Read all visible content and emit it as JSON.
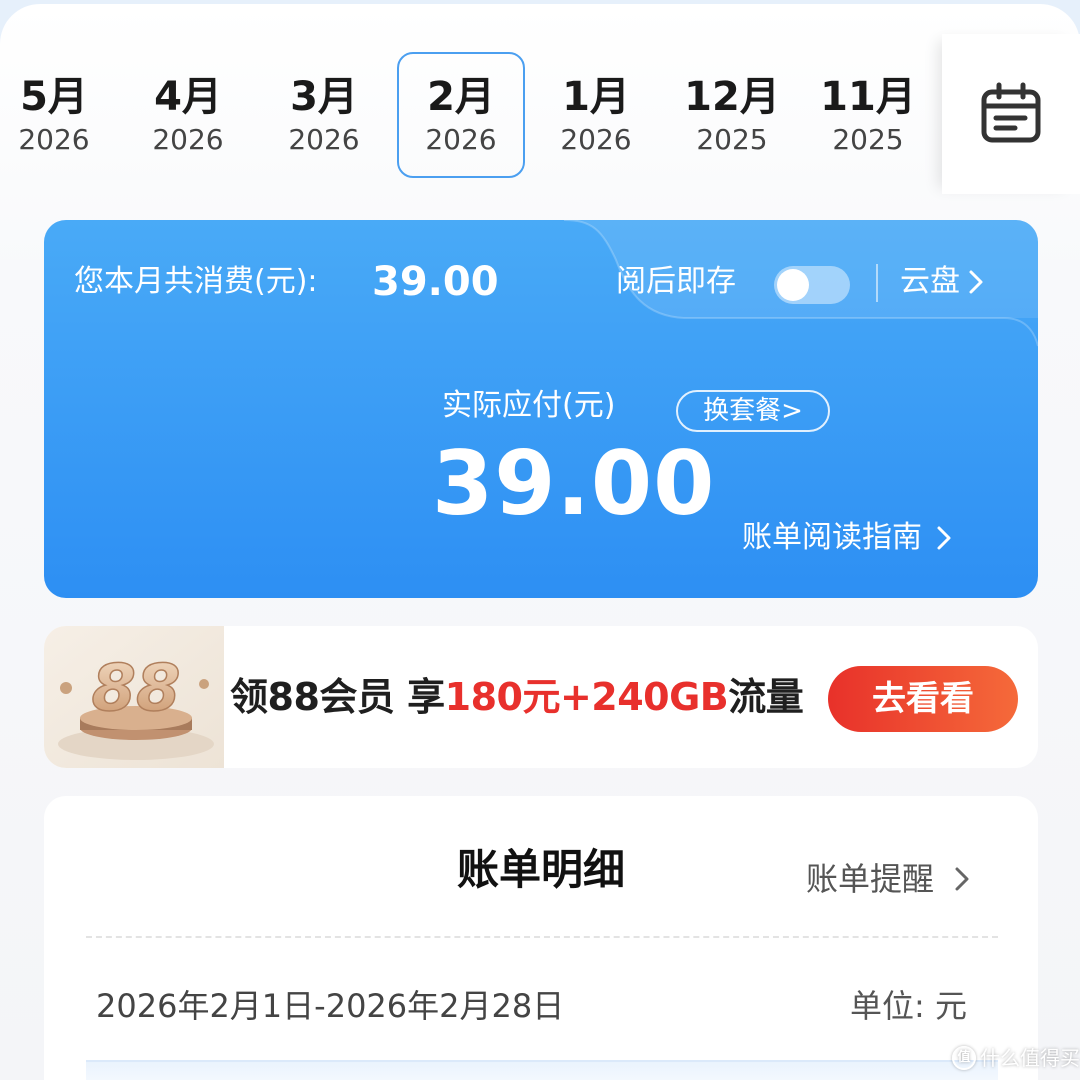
{
  "months": [
    {
      "month": "5月",
      "year": "2026"
    },
    {
      "month": "4月",
      "year": "2026"
    },
    {
      "month": "3月",
      "year": "2026"
    },
    {
      "month": "2月",
      "year": "2026"
    },
    {
      "month": "1月",
      "year": "2026"
    },
    {
      "month": "12月",
      "year": "2025"
    },
    {
      "month": "11月",
      "year": "2025"
    }
  ],
  "selected_month": "2月 2026",
  "calendar_icon": "calendar-icon",
  "summary": {
    "total_label": "您本月共消费(元):",
    "total_value": "39.00",
    "save_after_read_label": "阅后即存",
    "save_after_read_on": false,
    "cloud_label": "云盘",
    "actual_label": "实际应付(元)",
    "actual_value": "39.00",
    "change_plan_label": "换套餐>",
    "guide_label": "账单阅读指南"
  },
  "promo": {
    "badge": "88",
    "text_prefix": "领88会员 享",
    "text_highlight": "180元+240GB",
    "text_suffix": "流量",
    "button_label": "去看看"
  },
  "detail": {
    "title": "账单明细",
    "remind_label": "账单提醒",
    "period": "2026年2月1日-2026年2月28日",
    "unit": "单位: 元"
  },
  "watermark": {
    "mark": "值",
    "text": "什么值得买"
  },
  "colors": {
    "accent_blue": "#2d8ff3",
    "selected_border": "#4b9ff0",
    "promo_red": "#e8302c"
  }
}
